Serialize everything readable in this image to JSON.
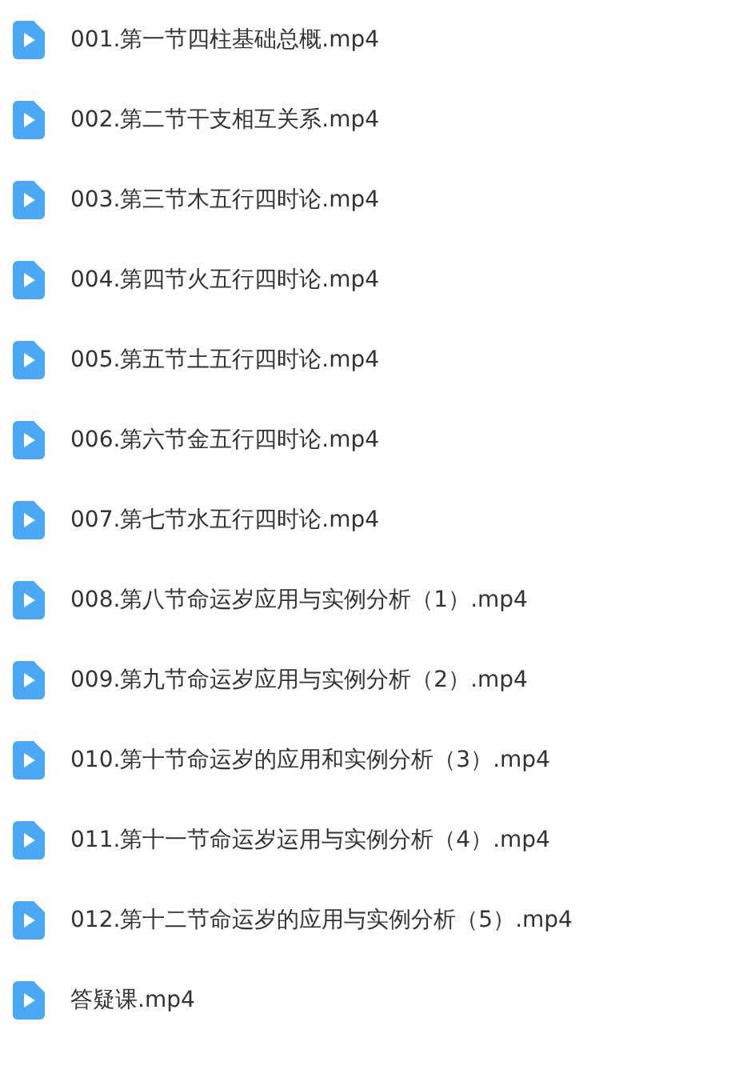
{
  "files": [
    {
      "name": "001.第一节四柱基础总概.mp4"
    },
    {
      "name": "002.第二节干支相互关系.mp4"
    },
    {
      "name": "003.第三节木五行四时论.mp4"
    },
    {
      "name": "004.第四节火五行四时论.mp4"
    },
    {
      "name": "005.第五节土五行四时论.mp4"
    },
    {
      "name": "006.第六节金五行四时论.mp4"
    },
    {
      "name": "007.第七节水五行四时论.mp4"
    },
    {
      "name": "008.第八节命运岁应用与实例分析（1）.mp4"
    },
    {
      "name": "009.第九节命运岁应用与实例分析（2）.mp4"
    },
    {
      "name": "010.第十节命运岁的应用和实例分析（3）.mp4"
    },
    {
      "name": "011.第十一节命运岁运用与实例分析（4）.mp4"
    },
    {
      "name": "012.第十二节命运岁的应用与实例分析（5）.mp4"
    },
    {
      "name": "答疑课.mp4"
    }
  ]
}
